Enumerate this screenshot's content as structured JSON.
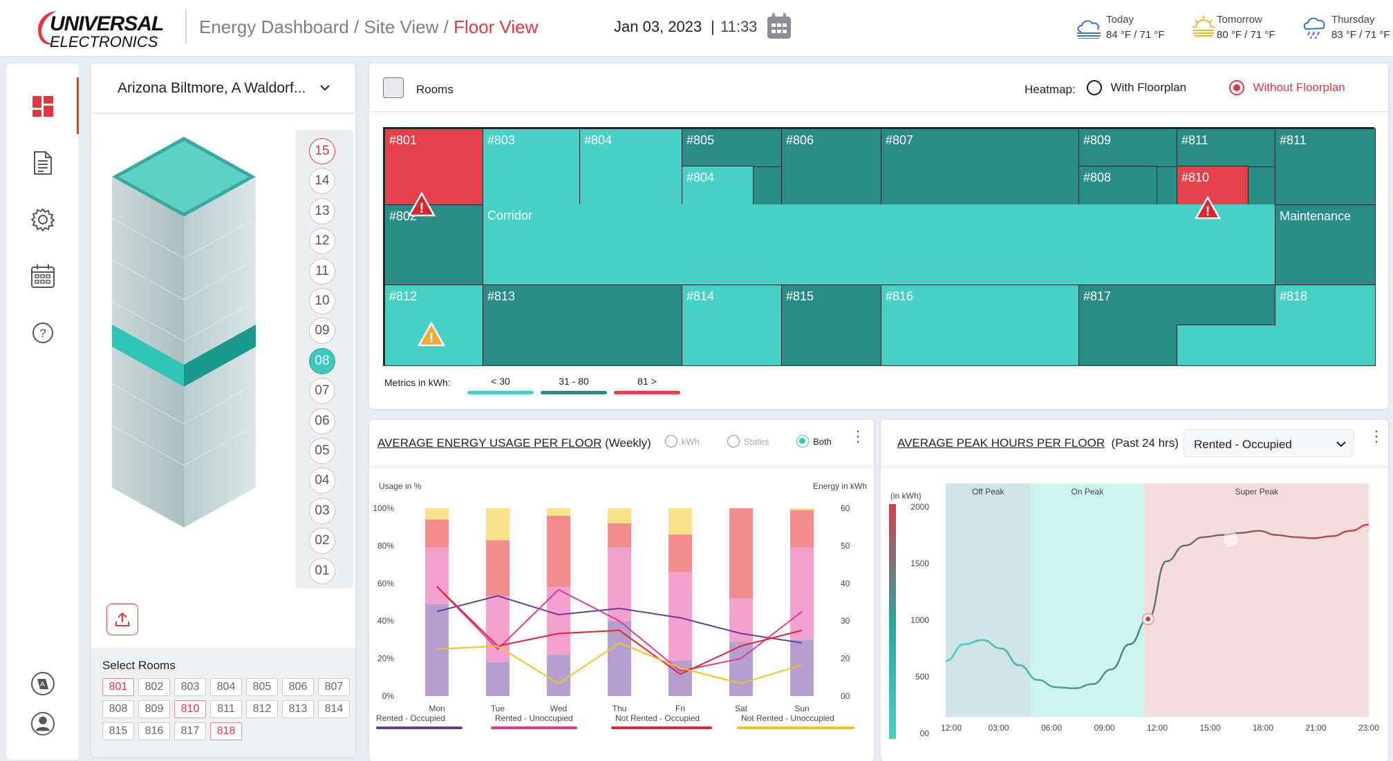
{
  "header": {
    "logo_top": "UNIVERSAL",
    "logo_bottom": "ELECTRONICS",
    "crumb_1": "Energy Dashboard",
    "crumb_sep1": " / ",
    "crumb_2": "Site View",
    "crumb_sep2": " / ",
    "crumb_3": "Floor View",
    "date": "Jan 03, 2023",
    "time_sep": "|",
    "time": "11:33",
    "weather": [
      {
        "day": "Today",
        "temp": "84 °F / 71 °F",
        "icon": "cloud-icon"
      },
      {
        "day": "Tomorrow",
        "temp": "80 °F / 71 °F",
        "icon": "sun-icon"
      },
      {
        "day": "Thursday",
        "temp": "83 °F / 71 °F",
        "icon": "rain-icon"
      }
    ]
  },
  "nav": {
    "items": [
      "dashboard-icon",
      "document-icon",
      "settings-icon",
      "calendar-icon",
      "help-icon"
    ],
    "bottom": [
      "translate-icon",
      "user-icon"
    ]
  },
  "building": {
    "site_select": "Arizona Biltmore, A Waldorf...",
    "floors": [
      "15",
      "14",
      "13",
      "12",
      "11",
      "10",
      "09",
      "08",
      "07",
      "06",
      "05",
      "04",
      "03",
      "02",
      "01"
    ],
    "selected_floor": "08",
    "select_rooms_label": "Select Rooms",
    "rooms": [
      {
        "id": "801",
        "alert": true
      },
      {
        "id": "802",
        "alert": false
      },
      {
        "id": "803",
        "alert": false
      },
      {
        "id": "804",
        "alert": false
      },
      {
        "id": "805",
        "alert": false
      },
      {
        "id": "806",
        "alert": false
      },
      {
        "id": "807",
        "alert": false
      },
      {
        "id": "808",
        "alert": false
      },
      {
        "id": "809",
        "alert": false
      },
      {
        "id": "810",
        "alert": true
      },
      {
        "id": "811",
        "alert": false
      },
      {
        "id": "812",
        "alert": false
      },
      {
        "id": "813",
        "alert": false
      },
      {
        "id": "814",
        "alert": false
      },
      {
        "id": "815",
        "alert": false
      },
      {
        "id": "816",
        "alert": false
      },
      {
        "id": "817",
        "alert": false
      },
      {
        "id": "818",
        "alert": true
      }
    ]
  },
  "floorplan": {
    "rooms_label": "Rooms",
    "heatmap_label": "Heatmap:",
    "with_floorplan": "With Floorplan",
    "without_floorplan": "Without Floorplan",
    "heatmap_selected": "Without Floorplan",
    "room_labels": {
      "r801": "#801",
      "r803": "#803",
      "r804a": "#804",
      "r805": "#805",
      "r804b": "#804",
      "r806": "#806",
      "r807": "#807",
      "r809": "#809",
      "r808": "#808",
      "r811a": "#811",
      "r810": "#810",
      "r811b": "#811",
      "r802": "#802",
      "corridor": "Corridor",
      "maintenance": "Maintenance",
      "r812": "#812",
      "r813": "#813",
      "r814": "#814",
      "r815": "#815",
      "r816": "#816",
      "r817": "#817",
      "r818": "#818"
    },
    "metrics_label": "Metrics in kWh:",
    "legend": [
      {
        "label": "< 30",
        "color": "#45d1c3"
      },
      {
        "label": "31 - 80",
        "color": "#2a8d85"
      },
      {
        "label": "81 >",
        "color": "#e8404a"
      }
    ]
  },
  "energy_panel": {
    "title": "AVERAGE ENERGY USAGE PER FLOOR",
    "subtitle": "(Weekly)",
    "options": [
      "kWh",
      "States",
      "Both"
    ],
    "selected": "Both",
    "colors": {
      "occ": "#b49fd0",
      "unocc": "#f3a2cf",
      "nr_occ": "#f28b8b",
      "nr_unocc": "#fbe08a"
    }
  },
  "peak_panel": {
    "title": "AVERAGE PEAK HOURS PER FLOOR",
    "subtitle": "(Past 24 hrs)",
    "dropdown": "Rented - Occupied",
    "colors": {
      "off": "#cfe4e6",
      "on": "#cdf5f0",
      "super": "#f6dcdc"
    }
  },
  "chart_data": [
    {
      "type": "bar",
      "title": "AVERAGE ENERGY USAGE PER FLOOR",
      "ylabel": "Usage in %",
      "y2label": "Energy in kWh",
      "ylim": [
        0,
        100
      ],
      "y2lim": [
        0,
        60
      ],
      "yticks": [
        "100%",
        "80%",
        "60%",
        "40%",
        "20%",
        "0%"
      ],
      "y2ticks": [
        "60",
        "50",
        "40",
        "30",
        "20",
        "00"
      ],
      "categories": [
        "Mon",
        "Tue",
        "Wed",
        "Thu",
        "Fri",
        "Sat",
        "Sun"
      ],
      "stacked_series": [
        {
          "name": "Rented - Occupied",
          "values": [
            49,
            18,
            22,
            40,
            19,
            29,
            30
          ]
        },
        {
          "name": "Rented - Unoccupied",
          "values": [
            30,
            35,
            36,
            39,
            47,
            23,
            49
          ]
        },
        {
          "name": "Not Rented - Occupied",
          "values": [
            15,
            30,
            38,
            13,
            20,
            48,
            20
          ]
        },
        {
          "name": "Not Rented - Unoccupied",
          "values": [
            6,
            17,
            4,
            8,
            14,
            0,
            1
          ]
        }
      ],
      "line_series": [
        {
          "name": "Rented - Occupied",
          "color": "#6a3d9a",
          "values": [
            27,
            32,
            26,
            28,
            25,
            20,
            17
          ]
        },
        {
          "name": "Rented - Unoccupied",
          "color": "#e0389a",
          "values": [
            35,
            15,
            34,
            24,
            8,
            12,
            27
          ]
        },
        {
          "name": "Not Rented - Occupied",
          "color": "#e8202f",
          "values": [
            35,
            16,
            20,
            21,
            7,
            16,
            21
          ]
        },
        {
          "name": "Not Rented - Unoccupied",
          "color": "#f5c21b",
          "values": [
            15,
            16,
            4,
            17,
            9,
            4,
            10
          ]
        }
      ]
    },
    {
      "type": "line",
      "title": "AVERAGE PEAK HOURS PER FLOOR",
      "ylabel": "(in kWh)",
      "ylim": [
        0,
        2000
      ],
      "yticks": [
        "2000",
        "1500",
        "1000",
        "500",
        "00"
      ],
      "xticks": [
        "12:00",
        "03:00",
        "06:00",
        "09:00",
        "12:00",
        "15:00",
        "18:00",
        "21:00",
        "23:00"
      ],
      "zones": [
        "Off Peak",
        "On Peak",
        "Super Peak"
      ],
      "x": [
        0,
        1,
        2,
        3,
        4,
        5,
        6,
        7,
        8,
        9,
        10,
        11,
        12,
        13,
        14,
        15,
        16,
        17,
        18,
        19,
        20,
        21,
        22,
        23
      ],
      "values": [
        400,
        560,
        600,
        520,
        360,
        220,
        150,
        140,
        180,
        320,
        560,
        800,
        1350,
        1500,
        1580,
        1600,
        1620,
        1640,
        1600,
        1580,
        1570,
        1590,
        1640,
        1700
      ],
      "markers": [
        {
          "label": "current",
          "x": 11
        }
      ]
    }
  ]
}
